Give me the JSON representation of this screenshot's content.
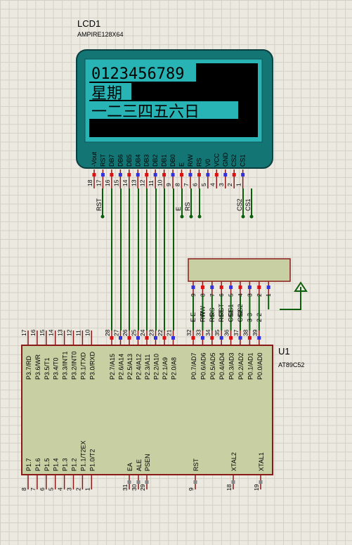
{
  "lcd": {
    "ref": "LCD1",
    "part": "AMPIRE128X64",
    "lines": [
      "0123456789",
      "星期",
      "一二三四五六日"
    ],
    "pins": [
      {
        "name": "-Vout",
        "num": "18"
      },
      {
        "name": "RST",
        "num": "17"
      },
      {
        "name": "DB7",
        "num": "16"
      },
      {
        "name": "DB6",
        "num": "15"
      },
      {
        "name": "DB5",
        "num": "14"
      },
      {
        "name": "DB4",
        "num": "13"
      },
      {
        "name": "DB3",
        "num": "12"
      },
      {
        "name": "DB2",
        "num": "11"
      },
      {
        "name": "DB1",
        "num": "10"
      },
      {
        "name": "DB0",
        "num": "9"
      },
      {
        "name": "E",
        "num": "8"
      },
      {
        "name": "R/W",
        "num": "7"
      },
      {
        "name": "RS",
        "num": "6"
      },
      {
        "name": "V0",
        "num": "5"
      },
      {
        "name": "VCC",
        "num": "4"
      },
      {
        "name": "GND",
        "num": "3"
      },
      {
        "name": "CS2",
        "num": "2"
      },
      {
        "name": "CS1",
        "num": "1"
      }
    ],
    "net_labels": [
      {
        "text": "RST"
      },
      {
        "text": "E"
      },
      {
        "text": "RS"
      },
      {
        "text": "CS2"
      },
      {
        "text": "CS1"
      }
    ]
  },
  "connector": {
    "pins": [
      {
        "name": "E",
        "num": "9"
      },
      {
        "name": "RW",
        "num": "8"
      },
      {
        "name": "RS",
        "num": "7"
      },
      {
        "name": "RST",
        "num": "6"
      },
      {
        "name": "CS1",
        "num": "5"
      },
      {
        "name": "CS2",
        "num": "4"
      },
      {
        "name": "3",
        "num": "3"
      },
      {
        "name": "2",
        "num": "2"
      },
      {
        "name": "",
        "num": "1"
      }
    ]
  },
  "mcu": {
    "ref": "U1",
    "part": "AT89C52",
    "top_pins": [
      {
        "name": "P3.7/RD",
        "num": "17"
      },
      {
        "name": "P3.6/WR",
        "num": "16"
      },
      {
        "name": "P3.5/T1",
        "num": "15"
      },
      {
        "name": "P3.4/T0",
        "num": "14"
      },
      {
        "name": "P3.3/INT1",
        "num": "13"
      },
      {
        "name": "P3.2/INT0",
        "num": "12"
      },
      {
        "name": "P3.1/TXD",
        "num": "11"
      },
      {
        "name": "P3.0/RXD",
        "num": "10"
      },
      {
        "name": "P2.7/A15",
        "num": "28"
      },
      {
        "name": "P2.6/A14",
        "num": "27"
      },
      {
        "name": "P2.5/A13",
        "num": "26"
      },
      {
        "name": "P2.4/A12",
        "num": "25"
      },
      {
        "name": "P2.3/A11",
        "num": "24"
      },
      {
        "name": "P2.2/A10",
        "num": "23"
      },
      {
        "name": "P2.1/A9",
        "num": "22"
      },
      {
        "name": "P2.0/A8",
        "num": "21"
      },
      {
        "name": "P0.7/AD7",
        "num": "32"
      },
      {
        "name": "P0.6/AD6",
        "num": "33"
      },
      {
        "name": "P0.5/AD5",
        "num": "34"
      },
      {
        "name": "P0.4/AD4",
        "num": "35"
      },
      {
        "name": "P0.3/AD3",
        "num": "36"
      },
      {
        "name": "P0.2/AD2",
        "num": "37"
      },
      {
        "name": "P0.1/AD1",
        "num": "38"
      },
      {
        "name": "P0.0/AD0",
        "num": "39"
      }
    ],
    "top_net_labels": [
      "E",
      "RW",
      "RS",
      "RST",
      "CS1",
      "CS2",
      "3",
      "2"
    ],
    "bottom_pins": [
      {
        "name": "P1.7",
        "num": "8"
      },
      {
        "name": "P1.6",
        "num": "7"
      },
      {
        "name": "P1.5",
        "num": "6"
      },
      {
        "name": "P1.4",
        "num": "5"
      },
      {
        "name": "P1.3",
        "num": "4"
      },
      {
        "name": "P1.2",
        "num": "3"
      },
      {
        "name": "P1.1/T2EX",
        "num": "2"
      },
      {
        "name": "P1.0/T2",
        "num": "1"
      },
      {
        "name": "EA",
        "num": "31"
      },
      {
        "name": "ALE",
        "num": "30"
      },
      {
        "name": "PSEN",
        "num": "29"
      },
      {
        "name": "RST",
        "num": "9"
      },
      {
        "name": "XTAL2",
        "num": "18"
      },
      {
        "name": "XTAL1",
        "num": "19"
      }
    ]
  },
  "colors": {
    "wire": "#0b5e0b",
    "body": "#c8cfa3",
    "body_border": "#8a1a1a",
    "lcd_body": "#147575",
    "lcd_screen": "#28b4b4",
    "pin": "#8a1a1a"
  }
}
